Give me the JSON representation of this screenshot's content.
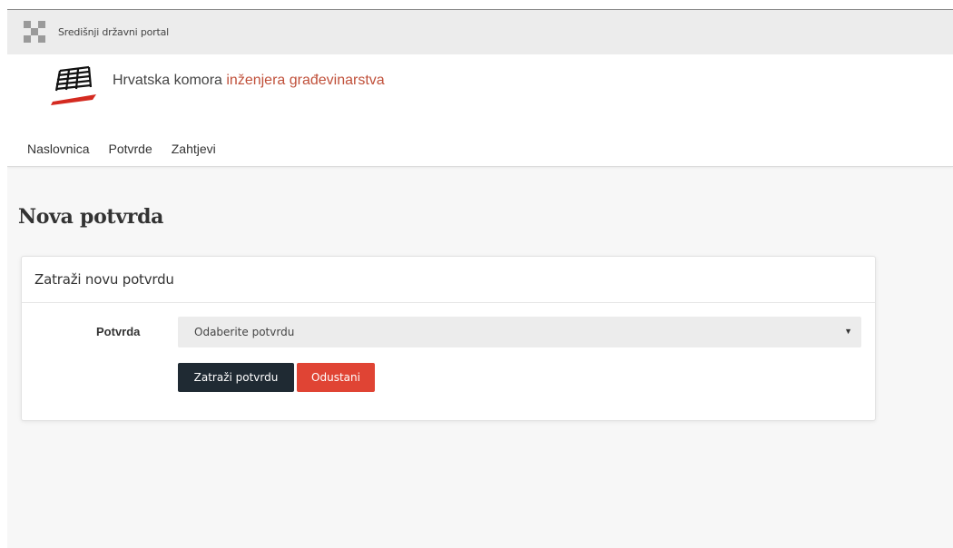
{
  "portal": {
    "name": "Središnji državni portal",
    "logo_icon": "croatian-checkerboard-icon"
  },
  "organization": {
    "title_plain": "Hrvatska komora ",
    "title_accent": "inženjera građevinarstva",
    "accent_color": "#c0503a",
    "logo_icon": "stacked-plates-logo-icon"
  },
  "nav": {
    "items": [
      {
        "label": "Naslovnica"
      },
      {
        "label": "Potvrde"
      },
      {
        "label": "Zahtjevi"
      }
    ]
  },
  "page": {
    "title": "Nova potvrda"
  },
  "card": {
    "title": "Zatraži novu potvrdu",
    "form": {
      "label": "Potvrda",
      "select_value": "Odaberite potvrdu",
      "select_icon": "dropdown-arrow-icon"
    },
    "buttons": {
      "submit_label": "Zatraži potvrdu",
      "submit_color": "#1f2a33",
      "cancel_label": "Odustani",
      "cancel_color": "#e04434"
    }
  }
}
